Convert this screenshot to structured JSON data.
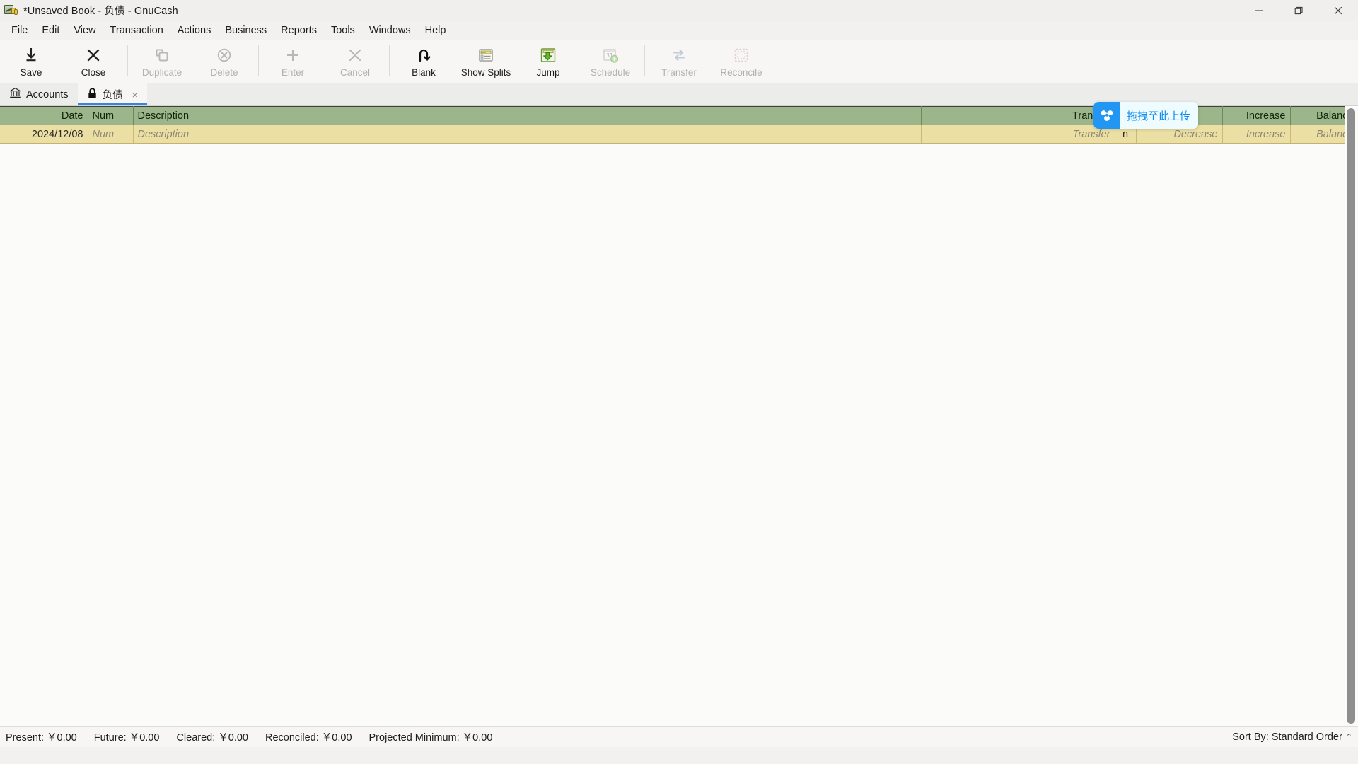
{
  "window": {
    "title": "*Unsaved Book - 负债 - GnuCash",
    "app_icon": "gnucash-icon",
    "controls": {
      "minimize": "minimize-icon",
      "restore": "restore-icon",
      "close": "close-icon"
    }
  },
  "menubar": {
    "items": [
      {
        "label": "File"
      },
      {
        "label": "Edit"
      },
      {
        "label": "View"
      },
      {
        "label": "Transaction"
      },
      {
        "label": "Actions"
      },
      {
        "label": "Business"
      },
      {
        "label": "Reports"
      },
      {
        "label": "Tools"
      },
      {
        "label": "Windows"
      },
      {
        "label": "Help"
      }
    ]
  },
  "toolbar": {
    "buttons": [
      {
        "label": "Save",
        "icon": "save-download-icon",
        "enabled": true
      },
      {
        "label": "Close",
        "icon": "close-x-icon",
        "enabled": true
      },
      {
        "label": "Duplicate",
        "icon": "duplicate-icon",
        "enabled": false
      },
      {
        "label": "Delete",
        "icon": "delete-circle-x-icon",
        "enabled": false
      },
      {
        "label": "Enter",
        "icon": "plus-icon",
        "enabled": false
      },
      {
        "label": "Cancel",
        "icon": "cancel-x-icon",
        "enabled": false
      },
      {
        "label": "Blank",
        "icon": "blank-arrow-icon",
        "enabled": true
      },
      {
        "label": "Show Splits",
        "icon": "show-splits-icon",
        "enabled": true
      },
      {
        "label": "Jump",
        "icon": "jump-icon",
        "enabled": true
      },
      {
        "label": "Schedule",
        "icon": "schedule-calendar-icon",
        "enabled": false
      },
      {
        "label": "Transfer",
        "icon": "transfer-icon",
        "enabled": false
      },
      {
        "label": "Reconcile",
        "icon": "reconcile-icon",
        "enabled": false
      }
    ]
  },
  "tabs": [
    {
      "label": "Accounts",
      "icon": "bank-icon",
      "active": false,
      "closable": false
    },
    {
      "label": "负债",
      "icon": "lock-icon",
      "active": true,
      "closable": true,
      "close_label": "×"
    }
  ],
  "register": {
    "columns": [
      {
        "label": "Date",
        "align": "right"
      },
      {
        "label": "Num",
        "align": "left"
      },
      {
        "label": "Description",
        "align": "left"
      },
      {
        "label": "Transfer",
        "align": "right"
      },
      {
        "label": "",
        "align": "center"
      },
      {
        "label": "",
        "align": "right"
      },
      {
        "label": "Increase",
        "align": "right"
      },
      {
        "label": "Balance",
        "align": "right"
      }
    ],
    "rows": [
      {
        "date": "2024/12/08",
        "num": "Num",
        "description": "Description",
        "transfer": "Transfer",
        "reconcile": "n",
        "decrease": "Decrease",
        "increase": "Increase",
        "balance": "Balance"
      }
    ]
  },
  "overlay": {
    "name": "baidu-netdisk-drop-target",
    "text": "拖拽至此上传",
    "icon": "baidu-netdisk-icon",
    "accent": "#2196f3",
    "text_color": "#0d8bf0",
    "background": "#eefbff"
  },
  "statusbar": {
    "present": "Present: ￥0.00",
    "future": "Future: ￥0.00",
    "cleared": "Cleared: ￥0.00",
    "reconciled": "Reconciled: ￥0.00",
    "projected_minimum": "Projected Minimum: ￥0.00",
    "sort_by": "Sort By: Standard Order",
    "sort_caret": "⌃"
  },
  "colors": {
    "header_green": "#9cb58a",
    "row_yellow": "#ecdfa4",
    "tab_accent": "#3584e4"
  }
}
